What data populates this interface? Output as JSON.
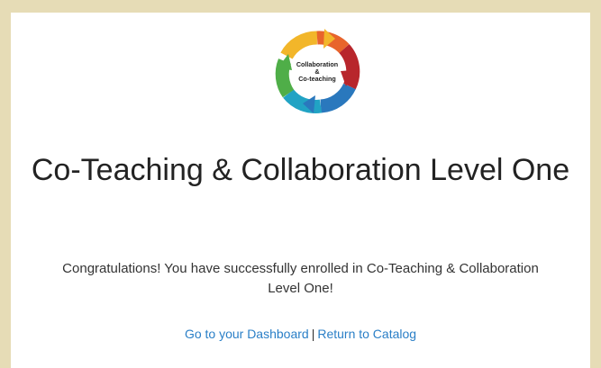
{
  "logo": {
    "line1": "Collaboration",
    "line2": "&",
    "line3": "Co-teaching",
    "colors": {
      "yellow": "#f2b62a",
      "orange": "#e8642c",
      "red": "#b8262c",
      "blue": "#2a78bd",
      "teal": "#21a3c4",
      "green": "#4fae48"
    }
  },
  "page": {
    "title": "Co-Teaching & Collaboration Level One",
    "message": "Congratulations! You have successfully enrolled in Co-Teaching & Collaboration Level One!"
  },
  "links": {
    "dashboard": "Go to your Dashboard",
    "separator": "|",
    "catalog": "Return to Catalog"
  },
  "colors": {
    "background": "#e6dcb6",
    "card": "#ffffff",
    "link": "#2a7fc7"
  }
}
